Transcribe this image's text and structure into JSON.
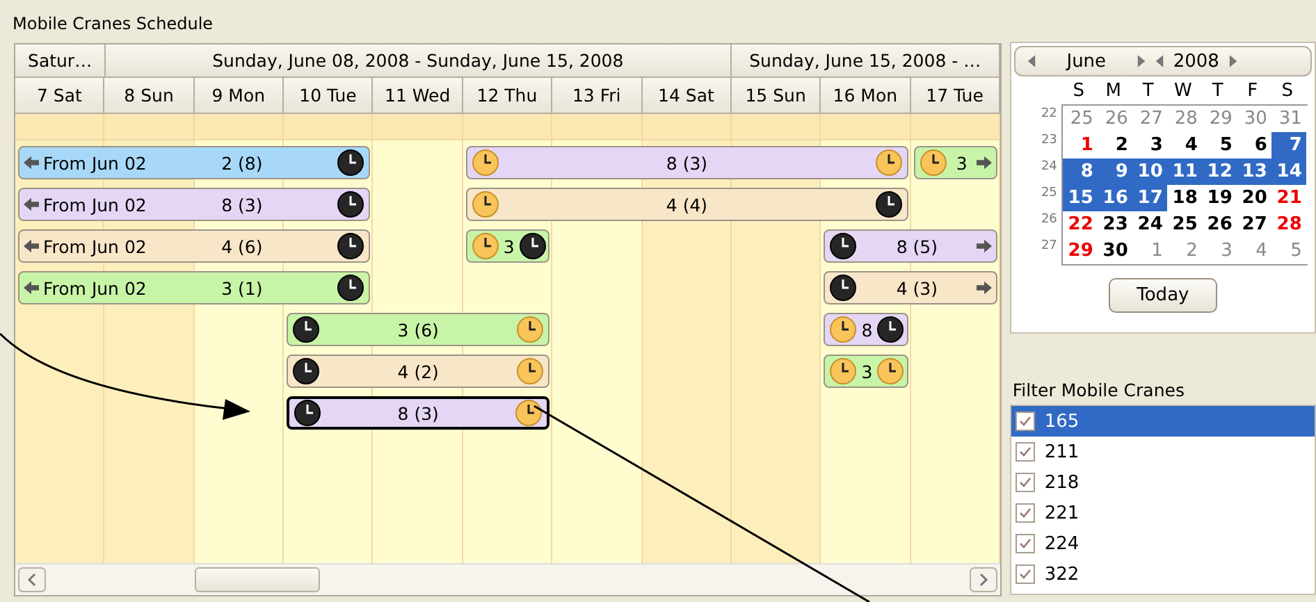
{
  "schedule": {
    "title": "Mobile Cranes Schedule",
    "week_headers": [
      {
        "label": "Satur…",
        "days": [
          {
            "label": "7 Sat",
            "weekend": true
          }
        ]
      },
      {
        "label": "Sunday, June 08, 2008 - Sunday, June 15, 2008",
        "days": [
          {
            "label": "8 Sun",
            "weekend": true
          },
          {
            "label": "9 Mon",
            "weekend": false
          },
          {
            "label": "10 Tue",
            "weekend": false
          },
          {
            "label": "11 Wed",
            "weekend": false
          },
          {
            "label": "12 Thu",
            "weekend": false
          },
          {
            "label": "13 Fri",
            "weekend": false
          },
          {
            "label": "14 Sat",
            "weekend": true
          }
        ]
      },
      {
        "label": "Sunday, June 15, 2008 - …",
        "days": [
          {
            "label": "15 Sun",
            "weekend": true
          },
          {
            "label": "16 Mon",
            "weekend": false
          },
          {
            "label": "17 Tue",
            "weekend": false
          }
        ]
      }
    ],
    "rows": [
      {
        "slots": [
          {
            "kind": "appointment",
            "color": "#a8d8f8",
            "label": "From Jun 02",
            "text": "2 (8)",
            "start": {
              "kind": "arrow"
            },
            "end": {
              "kind": "dark"
            },
            "selected": false
          },
          {
            "kind": "covered"
          },
          {
            "kind": "covered"
          },
          {
            "kind": "covered"
          },
          {
            "kind": "free"
          },
          {
            "kind": "appointment",
            "color": "#e4d6f4",
            "text": "8 (3)",
            "start": {
              "kind": "light"
            },
            "end": {
              "kind": "light"
            },
            "selected": false
          },
          {
            "kind": "covered"
          },
          {
            "kind": "covered"
          },
          {
            "kind": "covered"
          },
          {
            "kind": "covered"
          },
          {
            "kind": "appointment",
            "color": "#c8f4a8",
            "text": "3",
            "start": {
              "kind": "light"
            },
            "end": {
              "kind": "arrow"
            },
            "selected": false
          }
        ]
      },
      {
        "slots": [
          {
            "kind": "appointment",
            "color": "#e4d6f4",
            "label": "From Jun 02",
            "text": "8 (3)",
            "start": {
              "kind": "arrow"
            },
            "end": {
              "kind": "dark"
            },
            "selected": false
          },
          {
            "kind": "covered"
          },
          {
            "kind": "covered"
          },
          {
            "kind": "covered"
          },
          {
            "kind": "free"
          },
          {
            "kind": "appointment",
            "color": "#f8e6c8",
            "text": "4 (4)",
            "start": {
              "kind": "light"
            },
            "end": {
              "kind": "dark"
            },
            "selected": false
          },
          {
            "kind": "covered"
          },
          {
            "kind": "covered"
          },
          {
            "kind": "covered"
          },
          {
            "kind": "covered"
          },
          {
            "kind": "free"
          }
        ]
      },
      {
        "slots": [
          {
            "kind": "appointment",
            "color": "#f8e6c8",
            "label": "From Jun 02",
            "text": "4 (6)",
            "start": {
              "kind": "arrow"
            },
            "end": {
              "kind": "dark"
            },
            "selected": false
          },
          {
            "kind": "covered"
          },
          {
            "kind": "covered"
          },
          {
            "kind": "covered"
          },
          {
            "kind": "free"
          },
          {
            "kind": "appointment",
            "color": "#c8f4a8",
            "text": "3",
            "start": {
              "kind": "light"
            },
            "end": {
              "kind": "dark"
            },
            "selected": false
          },
          {
            "kind": "free"
          },
          {
            "kind": "free"
          },
          {
            "kind": "free"
          },
          {
            "kind": "appointment",
            "color": "#e4d6f4",
            "text": "8 (5)",
            "start": {
              "kind": "dark"
            },
            "end": {
              "kind": "arrow"
            },
            "selected": false
          },
          {
            "kind": "covered"
          }
        ]
      },
      {
        "slots": [
          {
            "kind": "appointment",
            "color": "#c8f4a8",
            "label": "From Jun 02",
            "text": "3 (1)",
            "start": {
              "kind": "arrow"
            },
            "end": {
              "kind": "dark"
            },
            "selected": false
          },
          {
            "kind": "covered"
          },
          {
            "kind": "covered"
          },
          {
            "kind": "covered"
          },
          {
            "kind": "free"
          },
          {
            "kind": "free"
          },
          {
            "kind": "free"
          },
          {
            "kind": "free"
          },
          {
            "kind": "free"
          },
          {
            "kind": "appointment",
            "color": "#f8e6c8",
            "text": "4 (3)",
            "start": {
              "kind": "dark"
            },
            "end": {
              "kind": "arrow"
            },
            "selected": false
          },
          {
            "kind": "covered"
          }
        ]
      },
      {
        "slots": [
          {
            "kind": "free"
          },
          {
            "kind": "free"
          },
          {
            "kind": "free"
          },
          {
            "kind": "appointment",
            "color": "#c8f4a8",
            "text": "3 (6)",
            "start": {
              "kind": "dark"
            },
            "end": {
              "kind": "light"
            },
            "selected": false
          },
          {
            "kind": "covered"
          },
          {
            "kind": "covered"
          },
          {
            "kind": "free"
          },
          {
            "kind": "free"
          },
          {
            "kind": "free"
          },
          {
            "kind": "appointment",
            "color": "#e4d6f4",
            "text": "8",
            "start": {
              "kind": "light"
            },
            "end": {
              "kind": "dark"
            },
            "selected": false
          },
          {
            "kind": "free"
          }
        ]
      },
      {
        "slots": [
          {
            "kind": "free"
          },
          {
            "kind": "free"
          },
          {
            "kind": "free"
          },
          {
            "kind": "appointment",
            "color": "#f8e6c8",
            "text": "4 (2)",
            "start": {
              "kind": "dark"
            },
            "end": {
              "kind": "light"
            },
            "selected": false
          },
          {
            "kind": "covered"
          },
          {
            "kind": "covered"
          },
          {
            "kind": "free"
          },
          {
            "kind": "free"
          },
          {
            "kind": "free"
          },
          {
            "kind": "appointment",
            "color": "#c8f4a8",
            "text": "3",
            "start": {
              "kind": "light"
            },
            "end": {
              "kind": "light"
            },
            "selected": false
          },
          {
            "kind": "free"
          }
        ]
      },
      {
        "slots": [
          {
            "kind": "free"
          },
          {
            "kind": "free"
          },
          {
            "kind": "free"
          },
          {
            "kind": "appointment",
            "color": "#e4d6f4",
            "text": "8 (3)",
            "start": {
              "kind": "dark"
            },
            "end": {
              "kind": "light"
            },
            "selected": true
          },
          {
            "kind": "covered"
          },
          {
            "kind": "covered"
          },
          {
            "kind": "free"
          },
          {
            "kind": "free"
          },
          {
            "kind": "free"
          },
          {
            "kind": "free"
          },
          {
            "kind": "free"
          }
        ]
      }
    ]
  },
  "calendar": {
    "month": "June",
    "year": "2008",
    "weekdays": [
      "S",
      "M",
      "T",
      "W",
      "T",
      "F",
      "S"
    ],
    "weeks": [
      {
        "number": "22",
        "days": [
          {
            "label": "25",
            "kind": "other",
            "selected": false
          },
          {
            "label": "26",
            "kind": "other",
            "selected": false
          },
          {
            "label": "27",
            "kind": "other",
            "selected": false
          },
          {
            "label": "28",
            "kind": "other",
            "selected": false
          },
          {
            "label": "29",
            "kind": "other",
            "selected": false
          },
          {
            "label": "30",
            "kind": "other",
            "selected": false
          },
          {
            "label": "31",
            "kind": "other",
            "selected": false
          }
        ]
      },
      {
        "number": "23",
        "days": [
          {
            "label": "1",
            "kind": "weekend",
            "selected": false
          },
          {
            "label": "2",
            "kind": "weekday",
            "selected": false
          },
          {
            "label": "3",
            "kind": "weekday",
            "selected": false
          },
          {
            "label": "4",
            "kind": "weekday",
            "selected": false
          },
          {
            "label": "5",
            "kind": "weekday",
            "selected": false
          },
          {
            "label": "6",
            "kind": "weekday",
            "selected": false
          },
          {
            "label": "7",
            "kind": "weekend",
            "selected": true
          }
        ]
      },
      {
        "number": "24",
        "days": [
          {
            "label": "8",
            "kind": "weekend",
            "selected": true
          },
          {
            "label": "9",
            "kind": "weekday",
            "selected": true
          },
          {
            "label": "10",
            "kind": "weekday",
            "selected": true
          },
          {
            "label": "11",
            "kind": "weekday",
            "selected": true
          },
          {
            "label": "12",
            "kind": "weekday",
            "selected": true
          },
          {
            "label": "13",
            "kind": "weekday",
            "selected": true
          },
          {
            "label": "14",
            "kind": "weekend",
            "selected": true
          }
        ]
      },
      {
        "number": "25",
        "days": [
          {
            "label": "15",
            "kind": "weekend",
            "selected": true
          },
          {
            "label": "16",
            "kind": "weekday",
            "selected": true
          },
          {
            "label": "17",
            "kind": "weekday",
            "selected": true
          },
          {
            "label": "18",
            "kind": "weekday",
            "selected": false
          },
          {
            "label": "19",
            "kind": "weekday",
            "selected": false
          },
          {
            "label": "20",
            "kind": "weekday",
            "selected": false
          },
          {
            "label": "21",
            "kind": "weekend",
            "selected": false
          }
        ]
      },
      {
        "number": "26",
        "days": [
          {
            "label": "22",
            "kind": "weekend",
            "selected": false
          },
          {
            "label": "23",
            "kind": "weekday",
            "selected": false
          },
          {
            "label": "24",
            "kind": "weekday",
            "selected": false
          },
          {
            "label": "25",
            "kind": "weekday",
            "selected": false
          },
          {
            "label": "26",
            "kind": "weekday",
            "selected": false
          },
          {
            "label": "27",
            "kind": "weekday",
            "selected": false
          },
          {
            "label": "28",
            "kind": "weekend",
            "selected": false
          }
        ]
      },
      {
        "number": "27",
        "days": [
          {
            "label": "29",
            "kind": "weekend",
            "selected": false
          },
          {
            "label": "30",
            "kind": "weekday",
            "selected": false
          },
          {
            "label": "1",
            "kind": "other",
            "selected": false
          },
          {
            "label": "2",
            "kind": "other",
            "selected": false
          },
          {
            "label": "3",
            "kind": "other",
            "selected": false
          },
          {
            "label": "4",
            "kind": "other",
            "selected": false
          },
          {
            "label": "5",
            "kind": "other",
            "selected": false
          }
        ]
      }
    ],
    "today_button": "Today"
  },
  "filter": {
    "title": "Filter Mobile Cranes",
    "items": [
      {
        "label": "165",
        "checked": true,
        "selected": true
      },
      {
        "label": "211",
        "checked": true,
        "selected": false
      },
      {
        "label": "218",
        "checked": true,
        "selected": false
      },
      {
        "label": "221",
        "checked": true,
        "selected": false
      },
      {
        "label": "224",
        "checked": true,
        "selected": false
      },
      {
        "label": "322",
        "checked": true,
        "selected": false
      }
    ]
  }
}
